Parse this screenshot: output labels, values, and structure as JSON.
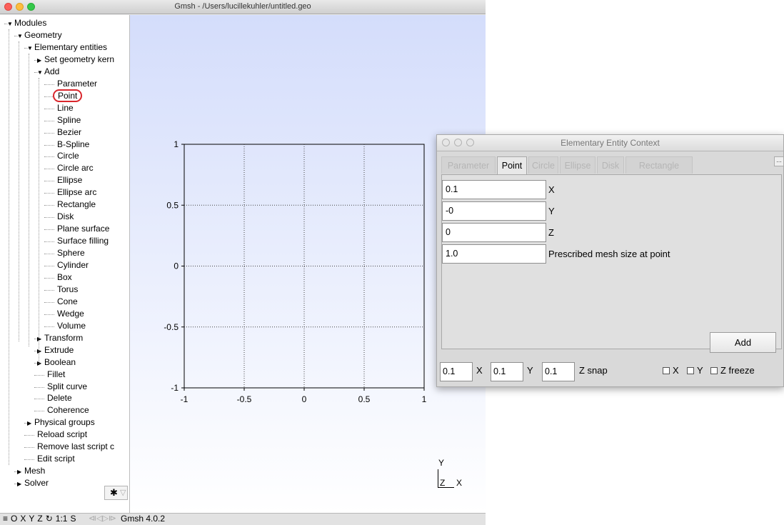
{
  "window": {
    "title": "Gmsh - /Users/lucillekuhler/untitled.geo",
    "lights": {
      "close": "#fc605b",
      "minimize": "#fdbc40",
      "zoom": "#34c84a"
    }
  },
  "tree": {
    "items": [
      {
        "label": "Modules",
        "expander": "open"
      },
      {
        "label": "Geometry",
        "expander": "open"
      },
      {
        "label": "Elementary entities",
        "expander": "open"
      },
      {
        "label": "Set geometry kern",
        "expander": "closed"
      },
      {
        "label": "Add",
        "expander": "open"
      },
      {
        "label": "Parameter",
        "expander": "none"
      },
      {
        "label": "Point",
        "expander": "none",
        "highlight": true
      },
      {
        "label": "Line",
        "expander": "none"
      },
      {
        "label": "Spline",
        "expander": "none"
      },
      {
        "label": "Bezier",
        "expander": "none"
      },
      {
        "label": "B-Spline",
        "expander": "none"
      },
      {
        "label": "Circle",
        "expander": "none"
      },
      {
        "label": "Circle arc",
        "expander": "none"
      },
      {
        "label": "Ellipse",
        "expander": "none"
      },
      {
        "label": "Ellipse arc",
        "expander": "none"
      },
      {
        "label": "Rectangle",
        "expander": "none"
      },
      {
        "label": "Disk",
        "expander": "none"
      },
      {
        "label": "Plane surface",
        "expander": "none"
      },
      {
        "label": "Surface filling",
        "expander": "none"
      },
      {
        "label": "Sphere",
        "expander": "none"
      },
      {
        "label": "Cylinder",
        "expander": "none"
      },
      {
        "label": "Box",
        "expander": "none"
      },
      {
        "label": "Torus",
        "expander": "none"
      },
      {
        "label": "Cone",
        "expander": "none"
      },
      {
        "label": "Wedge",
        "expander": "none"
      },
      {
        "label": "Volume",
        "expander": "none"
      },
      {
        "label": "Transform",
        "expander": "closed"
      },
      {
        "label": "Extrude",
        "expander": "closed"
      },
      {
        "label": "Boolean",
        "expander": "closed"
      },
      {
        "label": "Fillet",
        "expander": "none"
      },
      {
        "label": "Split curve",
        "expander": "none"
      },
      {
        "label": "Delete",
        "expander": "none"
      },
      {
        "label": "Coherence",
        "expander": "none"
      },
      {
        "label": "Physical groups",
        "expander": "closed"
      },
      {
        "label": "Reload script",
        "expander": "none"
      },
      {
        "label": "Remove last script c",
        "expander": "none"
      },
      {
        "label": "Edit script",
        "expander": "none"
      },
      {
        "label": "Mesh",
        "expander": "closed"
      },
      {
        "label": "Solver",
        "expander": "closed"
      }
    ],
    "highlight_color": "#d9262c"
  },
  "toolbar": {
    "gear_icon": "gear-icon",
    "filter_icon": "filter-icon"
  },
  "plot": {
    "x_ticks": [
      "-1",
      "-0.5",
      "0",
      "0.5",
      "1"
    ],
    "y_ticks": [
      "1",
      "0.5",
      "0",
      "-0.5",
      "-1"
    ],
    "xlim": [
      -1,
      1
    ],
    "ylim": [
      -1,
      1
    ],
    "grid": true
  },
  "axes_indicator": {
    "y": "Y",
    "z": "Z",
    "x": "X"
  },
  "status": {
    "items": [
      "≡",
      "O",
      "X",
      "Y",
      "Z",
      "↻",
      "1:1",
      "S"
    ],
    "version": "Gmsh 4.0.2"
  },
  "dialog": {
    "title": "Elementary Entity Context",
    "tabs": [
      "Parameter",
      "Point",
      "Circle",
      "Ellipse",
      "Disk",
      "Rectangle"
    ],
    "active_tab": "Point",
    "fields": [
      {
        "value": "0.1",
        "label": "X"
      },
      {
        "value": "-0",
        "label": "Y"
      },
      {
        "value": "0",
        "label": "Z"
      },
      {
        "value": "1.0",
        "label": "Prescribed mesh size at point"
      }
    ],
    "add_label": "Add",
    "snap": {
      "x_value": "0.1",
      "x_label": "X",
      "y_value": "0.1",
      "y_label": "Y",
      "z_value": "0.1",
      "z_label": "Z snap"
    },
    "freeze": {
      "x": "X",
      "y": "Y",
      "z": "Z freeze"
    }
  }
}
